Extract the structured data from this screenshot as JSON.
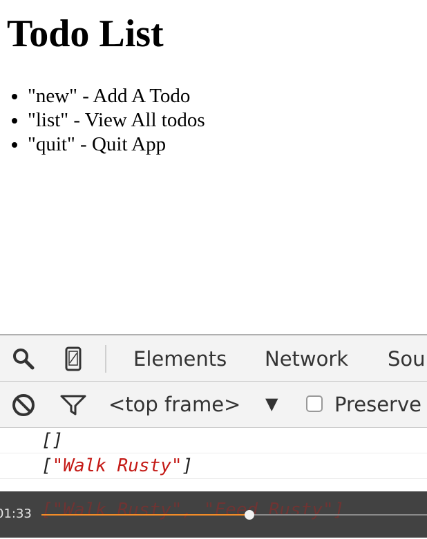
{
  "page": {
    "title": "Todo List",
    "commands": [
      "\"new\" - Add A Todo",
      "\"list\" - View All todos",
      "\"quit\" - Quit App"
    ]
  },
  "devtools": {
    "toolbar": {
      "icons": [
        "search-icon",
        "device-mode-icon"
      ],
      "tabs": [
        "Elements",
        "Network",
        "Sou"
      ]
    },
    "filterbar": {
      "icons": [
        "clear-console-icon",
        "filter-icon"
      ],
      "frame": "<top frame>",
      "frame_arrow": "▼",
      "preserve_label": "Preserve",
      "preserve_checked": false
    },
    "console": {
      "line1": {
        "open": "[",
        "close": "]"
      },
      "line2": {
        "open": "[",
        "item": "\"Walk Rusty\"",
        "close": "]"
      },
      "line3": "[\"Walk Rusty\", \"Feed Rusty\"]"
    }
  },
  "player": {
    "time": "01:33",
    "progress": 0.54,
    "fill_color": "#f28c28"
  }
}
